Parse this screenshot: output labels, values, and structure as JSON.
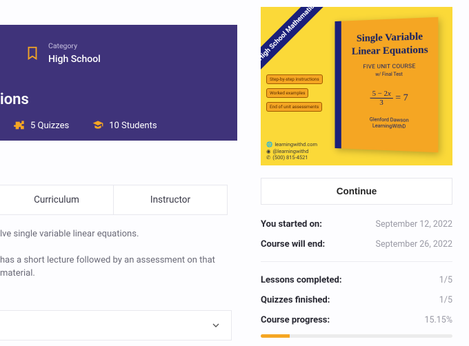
{
  "hero": {
    "category_label": "Category",
    "category_value": "High School",
    "title_fragment": "ions",
    "quizzes": "5 Quizzes",
    "students": "10 Students"
  },
  "tabs": {
    "curriculum": "Curriculum",
    "instructor": "Instructor"
  },
  "desc": {
    "line1": "lve single variable linear equations.",
    "line2": "has a short lecture followed by an assessment on that material."
  },
  "book": {
    "ribbon": "High School Mathematics",
    "title": "Single Variable Linear Equations",
    "subtitle": "FIVE UNIT COURSE",
    "subtitle2": "w/ Final Test",
    "author1": "Glenford Dawson",
    "author2": "LearningWithD",
    "pill1": "Step-by-step instructions",
    "pill2": "Worked examples",
    "pill3": "End of unit assessments",
    "soc1": "learningwithd.com",
    "soc2": "@learningwithd",
    "soc3": "(500) 815-4521"
  },
  "side": {
    "continue": "Continue",
    "started_k": "You started on:",
    "started_v": "September 12, 2022",
    "end_k": "Course will end:",
    "end_v": "September 26, 2022",
    "lessons_k": "Lessons completed:",
    "lessons_v": "1/5",
    "quizzes_k": "Quizzes finished:",
    "quizzes_v": "1/5",
    "progress_k": "Course progress:",
    "progress_v": "15.15%",
    "progress_pct": 15.15
  }
}
